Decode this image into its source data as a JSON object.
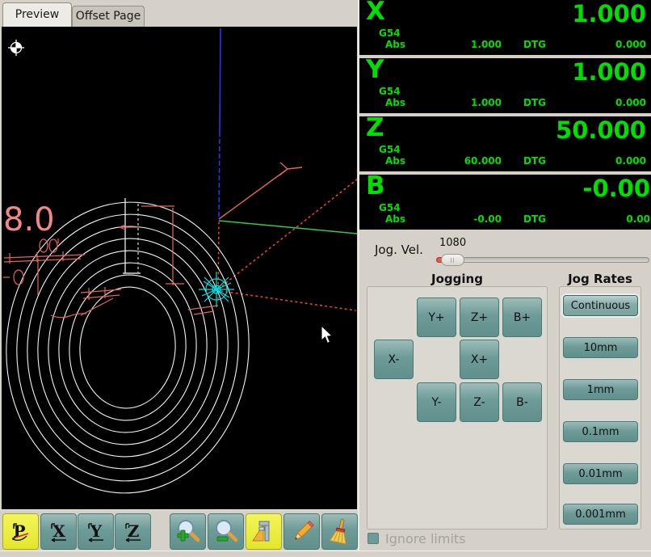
{
  "tabs": {
    "preview": "Preview",
    "offset": "Offset Page"
  },
  "preview": {
    "extent_text": "8.0",
    "dim_text_a": "00",
    "dim_text_b": "-0."
  },
  "dro": {
    "axes": [
      {
        "letter": "X",
        "system": "G54",
        "value": "1.000",
        "abs_label": "Abs",
        "abs": "1.000",
        "dtg_label": "DTG",
        "dtg": "0.000"
      },
      {
        "letter": "Y",
        "system": "G54",
        "value": "1.000",
        "abs_label": "Abs",
        "abs": "1.000",
        "dtg_label": "DTG",
        "dtg": "0.000"
      },
      {
        "letter": "Z",
        "system": "G54",
        "value": "50.000",
        "abs_label": "Abs",
        "abs": "60.000",
        "dtg_label": "DTG",
        "dtg": "0.000"
      },
      {
        "letter": "B",
        "system": "G54",
        "value": "-0.00",
        "abs_label": "Abs",
        "abs": "-0.00",
        "dtg_label": "DTG",
        "dtg": "0.00"
      }
    ]
  },
  "jog": {
    "vel_label": "Jog. Vel.",
    "vel_value": "1080",
    "jogging_title": "Jogging",
    "rates_title": "Jog Rates",
    "axis_buttons": {
      "yp": "Y+",
      "zp": "Z+",
      "bp": "B+",
      "xm": "X-",
      "xp": "X+",
      "ym": "Y-",
      "zm": "Z-",
      "bm": "B-"
    },
    "rates": [
      "Continuous",
      "10mm",
      "1mm",
      "0.1mm",
      "0.01mm",
      "0.001mm"
    ],
    "ignore_limits": "Ignore limits"
  },
  "toolbar": {
    "view_letters": {
      "p": "P",
      "x": "X",
      "y": "Y",
      "z": "Z"
    },
    "icons": [
      "perspective-view",
      "view-x",
      "view-y",
      "view-z",
      "zoom-in",
      "zoom-out",
      "tool-dimensions",
      "edit",
      "clear-plot"
    ]
  },
  "colors": {
    "dro_green": "#00e000",
    "dro_bg": "#000000",
    "button_teal": "#6d9b98",
    "active_yellow": "#e8ea3d",
    "slider_fill_red": "#e8584a",
    "axis_blue": "#3333ff",
    "axis_green": "#2ecc40",
    "dim_red": "#e86060",
    "tool_cyan": "#00dede",
    "path_white": "#ffffff"
  }
}
